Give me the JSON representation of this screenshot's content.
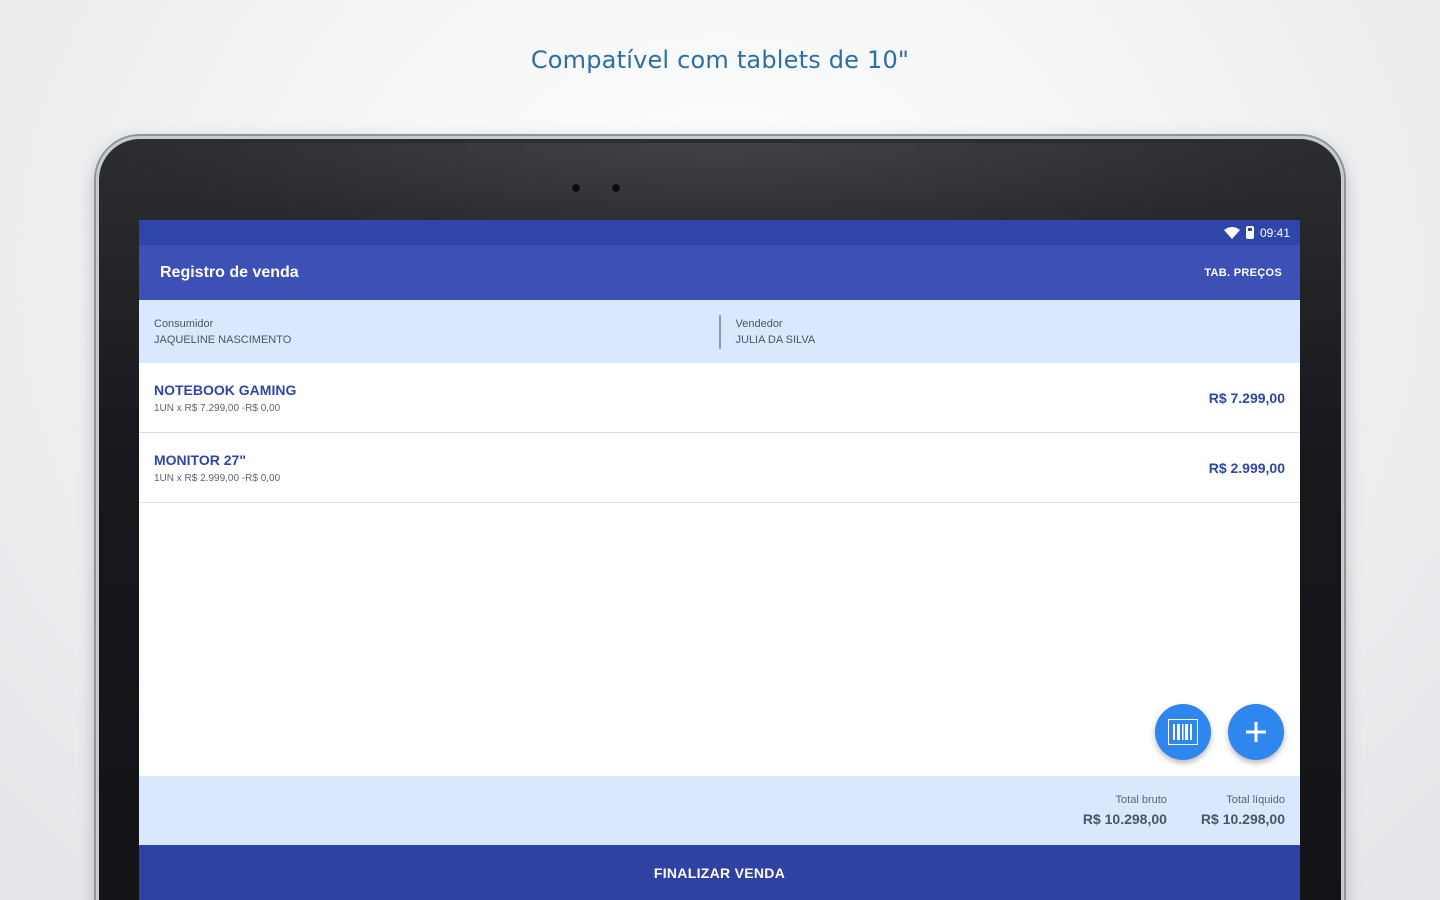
{
  "headline": "Compatível com tablets de 10\"",
  "status_bar": {
    "time": "09:41"
  },
  "appbar": {
    "title": "Registro de venda",
    "action": "TAB. PREÇOS"
  },
  "parties": {
    "consumer": {
      "label": "Consumidor",
      "value": "JAQUELINE NASCIMENTO"
    },
    "seller": {
      "label": "Vendedor",
      "value": "JULIA DA SILVA"
    }
  },
  "items": [
    {
      "name": "NOTEBOOK GAMING",
      "detail": "1UN x R$ 7.299,00 -R$ 0,00",
      "price": "R$ 7.299,00"
    },
    {
      "name": "MONITOR 27\"",
      "detail": "1UN x R$ 2.999,00 -R$ 0,00",
      "price": "R$ 2.999,00"
    }
  ],
  "totals": {
    "gross": {
      "label": "Total bruto",
      "value": "R$ 10.298,00"
    },
    "net": {
      "label": "Total líquido",
      "value": "R$ 10.298,00"
    }
  },
  "finish_button": "FINALIZAR VENDA",
  "icons": {
    "wifi": "wifi-icon",
    "battery": "battery-icon",
    "barcode": "barcode-icon",
    "add": "plus-icon"
  },
  "colors": {
    "primary": "#3d50b5",
    "status_bar": "#2f46a8",
    "fab": "#2f86ee",
    "panel": "#dae8fd",
    "headline": "#2d6ea6"
  }
}
